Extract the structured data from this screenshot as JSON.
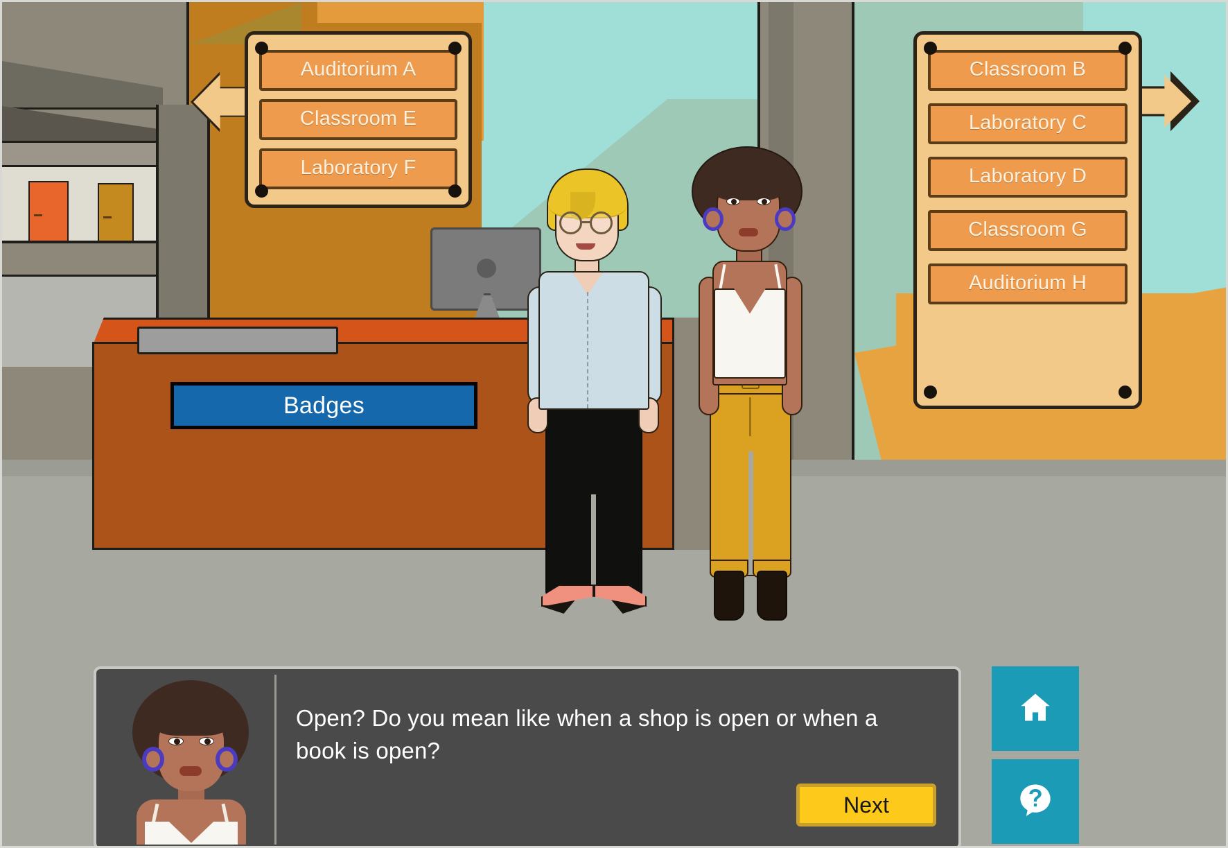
{
  "scene": {
    "description": "conference-centre-reception",
    "colors": {
      "sky_teal": "#9fdfd8",
      "wall_brown": "#c07d20",
      "desk_orange": "#ab5319",
      "ground_gray": "#a7a9a1",
      "sign_panel": "#f3c989",
      "sign_row": "#ef9b4e",
      "badges_blue": "#1568ac",
      "next_yellow": "#fdc91a",
      "side_button_teal": "#1c9bb6",
      "dialog_gray": "#4a4a4a"
    }
  },
  "signs": {
    "left": {
      "name": "left-direction-sign",
      "arrow_direction": "left",
      "rows": [
        {
          "label": "Auditorium A"
        },
        {
          "label": "Classroom E"
        },
        {
          "label": "Laboratory F"
        }
      ]
    },
    "right": {
      "name": "right-direction-sign",
      "arrow_direction": "right",
      "rows": [
        {
          "label": "Classroom B"
        },
        {
          "label": "Laboratory C"
        },
        {
          "label": "Laboratory D"
        },
        {
          "label": "Classroom G"
        },
        {
          "label": "Auditorium H"
        }
      ]
    }
  },
  "counter": {
    "badges_label": "Badges"
  },
  "characters": [
    {
      "name": "receptionist-blonde-glasses"
    },
    {
      "name": "visitor-afro-woman"
    }
  ],
  "dialog": {
    "speaker_avatar": "afro-woman-portrait",
    "text": "Open? Do you mean like when a shop is open or when a book is open?",
    "next_label": "Next"
  },
  "side_buttons": [
    {
      "name": "home-button",
      "icon": "home-icon"
    },
    {
      "name": "help-button",
      "icon": "question-mark-icon"
    }
  ]
}
